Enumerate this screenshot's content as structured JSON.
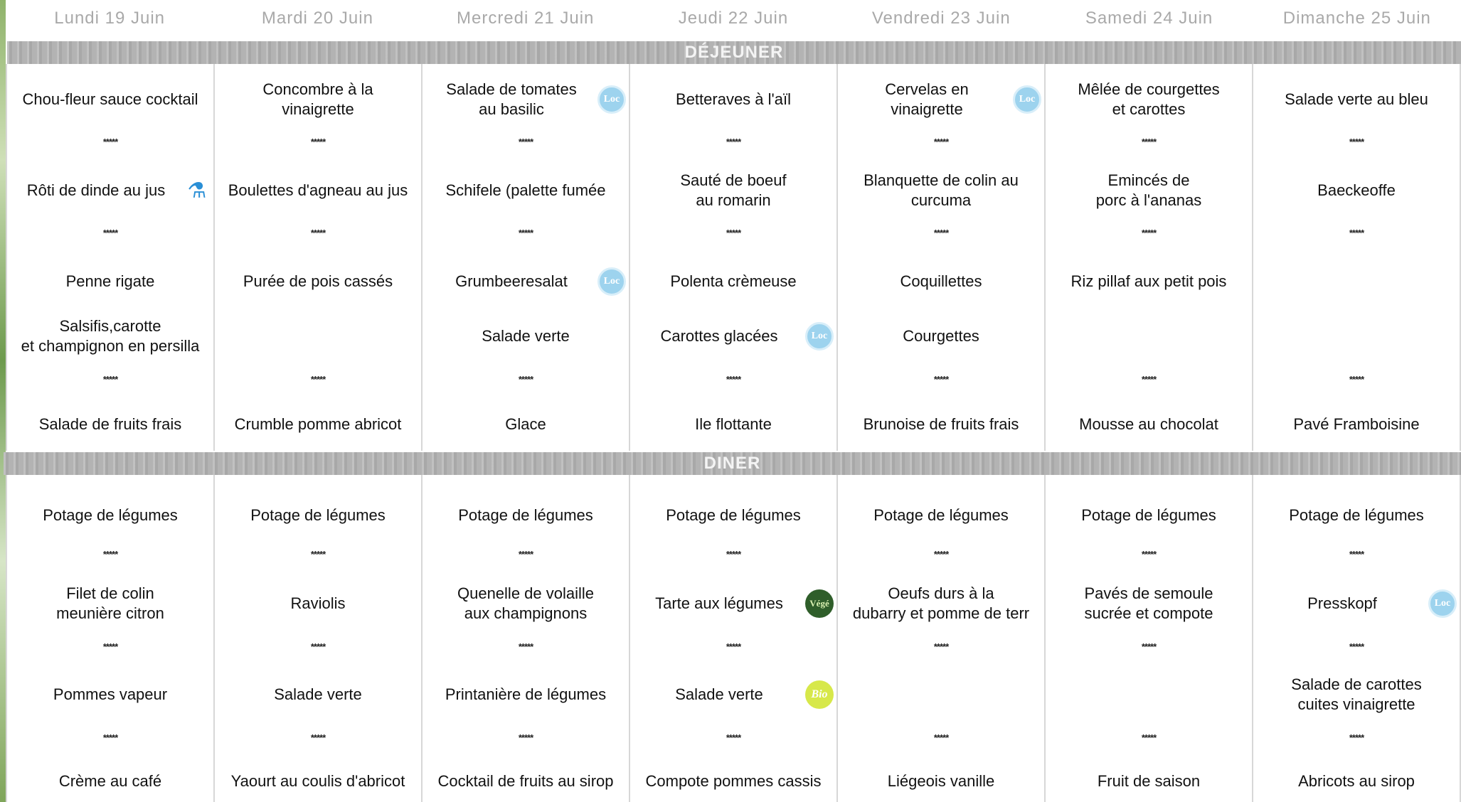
{
  "days": [
    "Lundi 19 Juin",
    "Mardi 20 Juin",
    "Mercredi 21 Juin",
    "Jeudi 22 Juin",
    "Vendredi 23 Juin",
    "Samedi 24 Juin",
    "Dimanche 25 Juin"
  ],
  "sections": {
    "dejeuner": "DÉJEUNER",
    "diner": "DINER"
  },
  "separator": "*****",
  "icons": {
    "local": {
      "label": "Loc",
      "color": "#9dd3ee"
    },
    "vege": {
      "label": "Végé",
      "color": "#2f5e2a"
    },
    "bio": {
      "label": "Bio",
      "color": "#d7e84a"
    },
    "bottle": {
      "label": "⚗",
      "color": "#2a8fd6"
    }
  },
  "dejeuner": [
    {
      "starter": "Chou-fleur sauce cocktail",
      "main": "Rôti de dinde au jus",
      "main_icon": "bottle",
      "side1": "Penne rigate",
      "side2": "Salsifis,carotte\net champignon en persilla",
      "dessert": "Salade de fruits frais"
    },
    {
      "starter": "Concombre à la\nvinaigrette",
      "main": "Boulettes d'agneau au jus",
      "side1": "Purée de pois cassés",
      "side2": "",
      "dessert": "Crumble pomme abricot"
    },
    {
      "starter": "Salade de tomates\nau basilic",
      "starter_icon": "local",
      "main": "Schifele (palette fumée",
      "side1": "Grumbeeresalat",
      "side1_icon": "local",
      "side2": "Salade verte",
      "dessert": "Glace"
    },
    {
      "starter": "Betteraves à l'aïl",
      "main": "Sauté de boeuf\nau romarin",
      "side1": "Polenta crèmeuse",
      "side2": "Carottes glacées",
      "side2_icon": "local",
      "dessert": "Ile flottante"
    },
    {
      "starter": "Cervelas en\nvinaigrette",
      "starter_icon": "local",
      "main": "Blanquette de colin au\ncurcuma",
      "side1": "Coquillettes",
      "side2": "Courgettes",
      "dessert": "Brunoise de fruits frais"
    },
    {
      "starter": "Mêlée de courgettes\net carottes",
      "main": "Emincés de\nporc à l'ananas",
      "side1": "Riz pillaf aux petit pois",
      "side2": "",
      "dessert": "Mousse au chocolat"
    },
    {
      "starter": "Salade verte au bleu",
      "main": "Baeckeoffe",
      "side1": "",
      "side2": "",
      "dessert": "Pavé Framboisine"
    }
  ],
  "diner": [
    {
      "soup": "Potage de légumes",
      "main": "Filet de colin\nmeunière citron",
      "side": "Pommes vapeur",
      "dessert": "Crème au café"
    },
    {
      "soup": "Potage de légumes",
      "main": "Raviolis",
      "side": "Salade verte",
      "dessert": "Yaourt au coulis d'abricot"
    },
    {
      "soup": "Potage de légumes",
      "main": "Quenelle de volaille\naux champignons",
      "side": "Printanière de légumes",
      "dessert": "Cocktail de fruits au sirop"
    },
    {
      "soup": "Potage de légumes",
      "main": "Tarte aux légumes",
      "main_icon": "vege",
      "side": "Salade verte",
      "side_icon": "bio",
      "dessert": "Compote pommes cassis"
    },
    {
      "soup": "Potage de légumes",
      "main": "Oeufs durs à la\ndubarry et pomme de terr",
      "side": "",
      "dessert": "Liégeois vanille"
    },
    {
      "soup": "Potage de légumes",
      "main": "Pavés  de semoule\nsucrée et compote",
      "side": "",
      "dessert": "Fruit de saison"
    },
    {
      "soup": "Potage de légumes",
      "main": "Presskopf",
      "main_icon": "local",
      "side": "Salade de carottes\ncuites vinaigrette",
      "dessert": "Abricots au sirop"
    }
  ]
}
